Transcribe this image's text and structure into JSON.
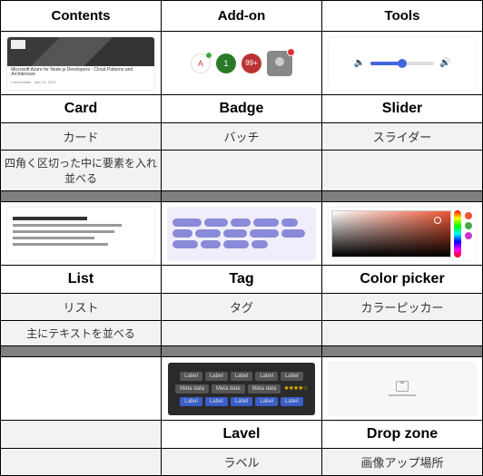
{
  "headers": {
    "c1": "Contents",
    "c2": "Add-on",
    "c3": "Tools"
  },
  "row1": {
    "c1": {
      "title": "Card",
      "sub": "カード",
      "desc": "四角く区切った中に要素を入れ並べる"
    },
    "c2": {
      "title": "Badge",
      "sub": "バッチ",
      "desc": ""
    },
    "c3": {
      "title": "Slider",
      "sub": "スライダー",
      "desc": ""
    },
    "thumb": {
      "card_line1": "Microsoft Azure for Node.js Developers - Cloud Patterns and Architecture",
      "card_line2": "Intermediate · Mar 13, 2020",
      "badge_a": "A",
      "badge_b": "1",
      "badge_c": "99+"
    }
  },
  "row2": {
    "c1": {
      "title": "List",
      "sub": "リスト",
      "desc": "主にテキストを並べる"
    },
    "c2": {
      "title": "Tag",
      "sub": "タグ",
      "desc": ""
    },
    "c3": {
      "title": "Color picker",
      "sub": "カラーピッカー",
      "desc": ""
    }
  },
  "row3": {
    "c1": {
      "title": "",
      "sub": "",
      "desc": ""
    },
    "c2": {
      "title": "Lavel",
      "sub": "ラベル",
      "desc": ""
    },
    "c3": {
      "title": "Drop zone",
      "sub": "画像アップ場所",
      "desc": ""
    },
    "thumb": {
      "label": "Label",
      "meta": "Meta data",
      "stars": "★★★★☆"
    }
  }
}
